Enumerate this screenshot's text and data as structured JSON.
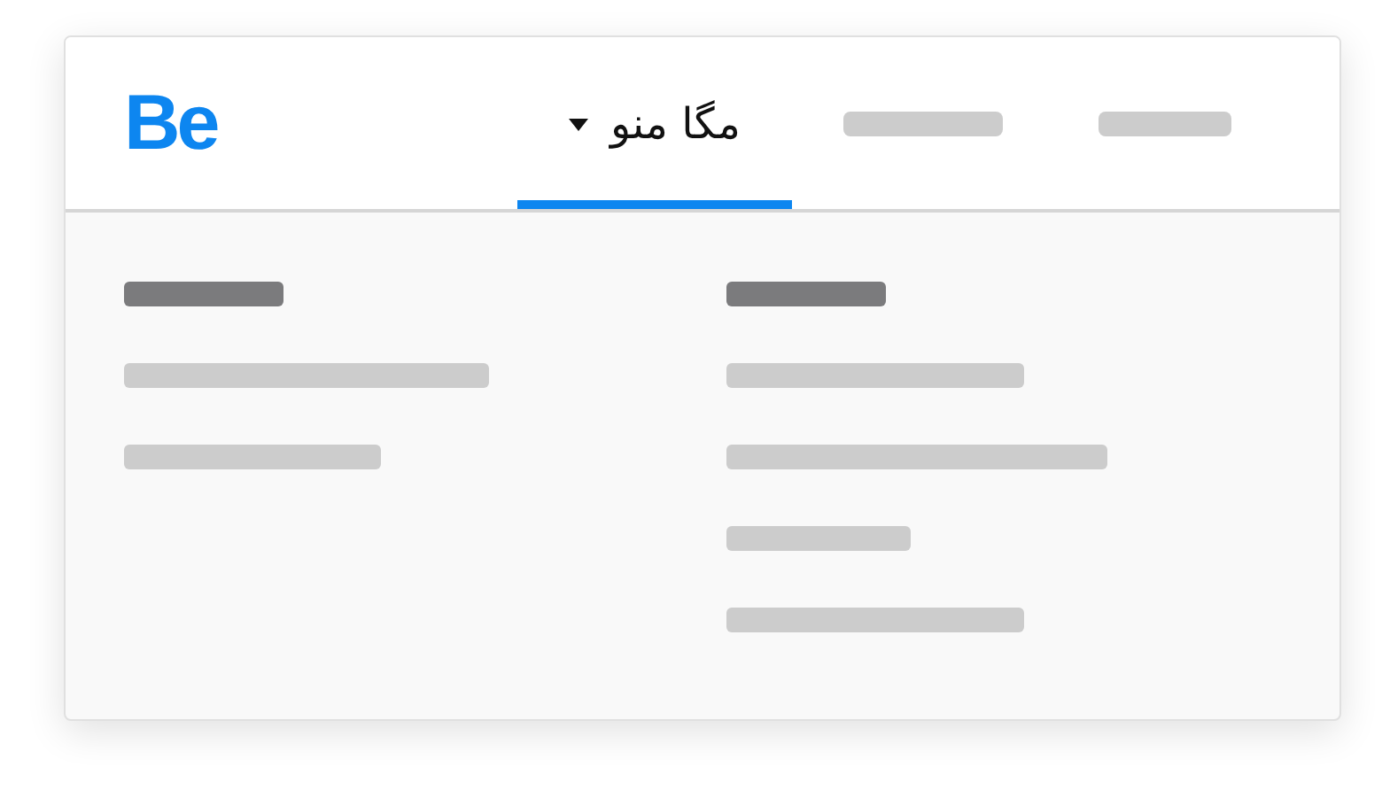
{
  "logo": "Be",
  "nav": [
    {
      "kind": "menu",
      "label": "مگا منو",
      "selected": true
    },
    {
      "kind": "placeholder",
      "selected": false
    },
    {
      "kind": "placeholder",
      "selected": false
    }
  ]
}
